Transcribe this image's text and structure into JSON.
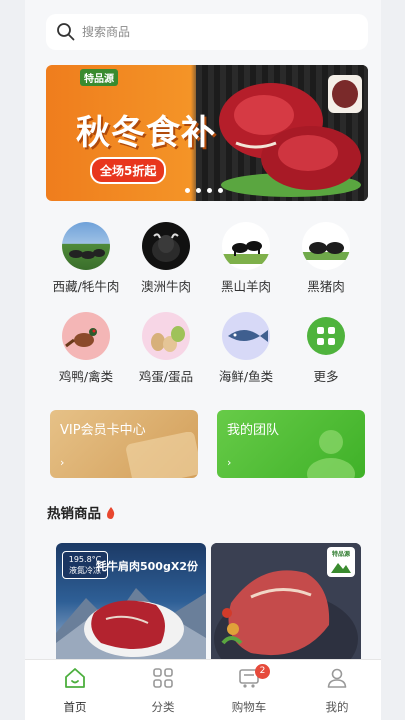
{
  "search": {
    "placeholder": "搜索商品"
  },
  "banner": {
    "logo": "特品源",
    "title": "秋冬食补",
    "badge": "全场5折起",
    "slides": 4,
    "active_slide": 1
  },
  "categories": [
    {
      "label": "西藏/牦牛肉",
      "icon": "yak-photo"
    },
    {
      "label": "澳洲牛肉",
      "icon": "cattle-photo"
    },
    {
      "label": "黑山羊肉",
      "icon": "goat-photo"
    },
    {
      "label": "黑猪肉",
      "icon": "pig-photo"
    },
    {
      "label": "鸡鸭/禽类",
      "icon": "pheasant-icon"
    },
    {
      "label": "鸡蛋/蛋品",
      "icon": "eggs-icon"
    },
    {
      "label": "海鲜/鱼类",
      "icon": "fish-icon"
    },
    {
      "label": "更多",
      "icon": "grid-icon"
    }
  ],
  "cards": {
    "vip": {
      "title": "VIP会员卡中心",
      "arrow": "›"
    },
    "team": {
      "title": "我的团队",
      "arrow": "›"
    }
  },
  "hot": {
    "title": "热销商品"
  },
  "products": [
    {
      "badge": "195.8°C 液氮冷冻",
      "name": "牦牛肩肉500gX2份"
    },
    {
      "logo": "特品源"
    }
  ],
  "tabbar": [
    {
      "label": "首页",
      "icon": "home-icon",
      "active": true
    },
    {
      "label": "分类",
      "icon": "category-grid-icon"
    },
    {
      "label": "购物车",
      "icon": "cart-icon",
      "badge": "2"
    },
    {
      "label": "我的",
      "icon": "user-icon"
    }
  ],
  "colors": {
    "accent": "#3cb133",
    "vip": "#dcae6c",
    "team": "#52bf38",
    "badge": "#e64a3b"
  }
}
